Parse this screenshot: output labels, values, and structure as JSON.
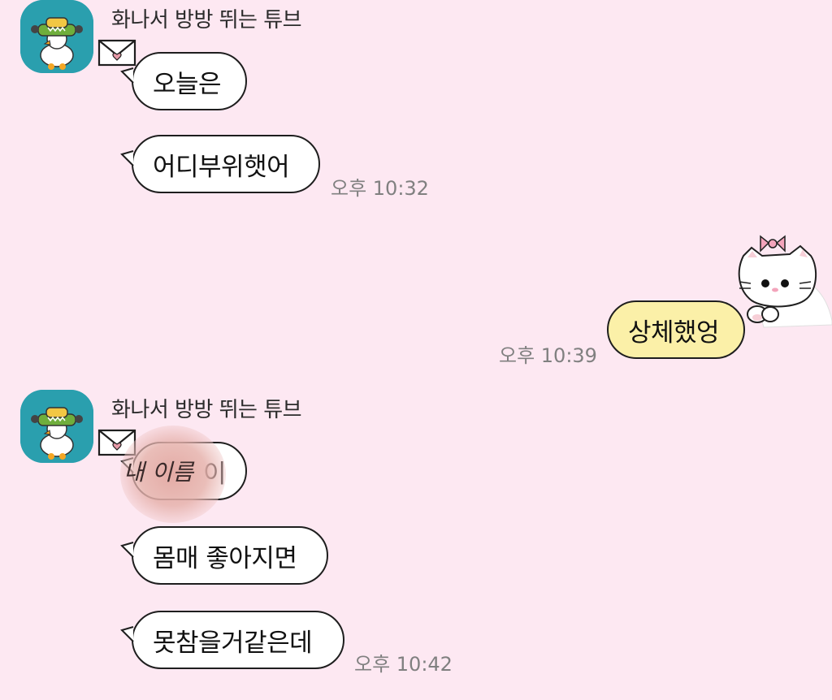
{
  "chat": {
    "groups": [
      {
        "sender": "화나서 방방 뛰는 튜브",
        "messages": [
          "오늘은",
          "어디부위햇어"
        ],
        "time": "오후 10:32"
      },
      {
        "sender": "me",
        "messages": [
          "상체했엉"
        ],
        "time": "오후 10:39"
      },
      {
        "sender": "화나서 방방 뛰는 튜브",
        "messages": [
          "내 이름이",
          "몸매 좋아지면",
          "못참을거같은데"
        ],
        "time": "오후 10:42"
      }
    ],
    "redaction_handwriting": "내 이름",
    "visible_after_redaction": "이"
  },
  "colors": {
    "background": "#fde8f2",
    "avatar_bg": "#2a9fae",
    "incoming_bubble": "#ffffff",
    "outgoing_bubble": "#fbf0a8",
    "timestamp": "#808080"
  },
  "icons": [
    "envelope-icon",
    "tube-avatar",
    "cat-sticker"
  ]
}
